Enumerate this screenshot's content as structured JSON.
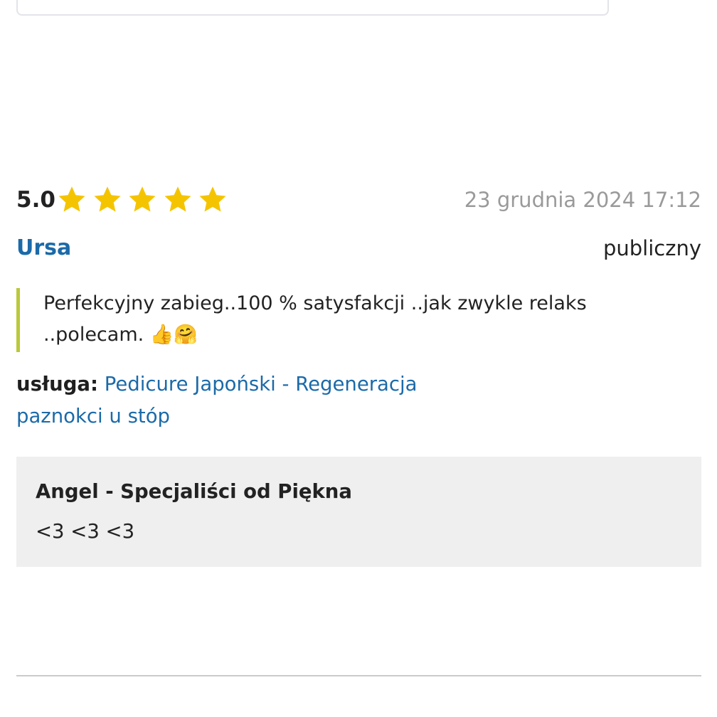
{
  "review": {
    "rating": "5.0",
    "stars": 5,
    "star_color": "#f5c400",
    "date": "23 grudnia 2024 17:12",
    "author": "Ursa",
    "visibility": "publiczny",
    "text": "Perfekcyjny zabieg..100 % satysfakcji ..jak zwykle relaks ..polecam. 👍🤗",
    "quote_border_color": "#b9c93a",
    "service_label": "usługa:",
    "service_name": "Pedicure Japoński - Regeneracja paznokci u stóp"
  },
  "reply": {
    "author": "Angel - Specjaliści od Piękna",
    "text": "<3 <3 <3"
  },
  "colors": {
    "link": "#1b6aa9",
    "muted": "#9a9a9a",
    "reply_bg": "#efeff0"
  }
}
